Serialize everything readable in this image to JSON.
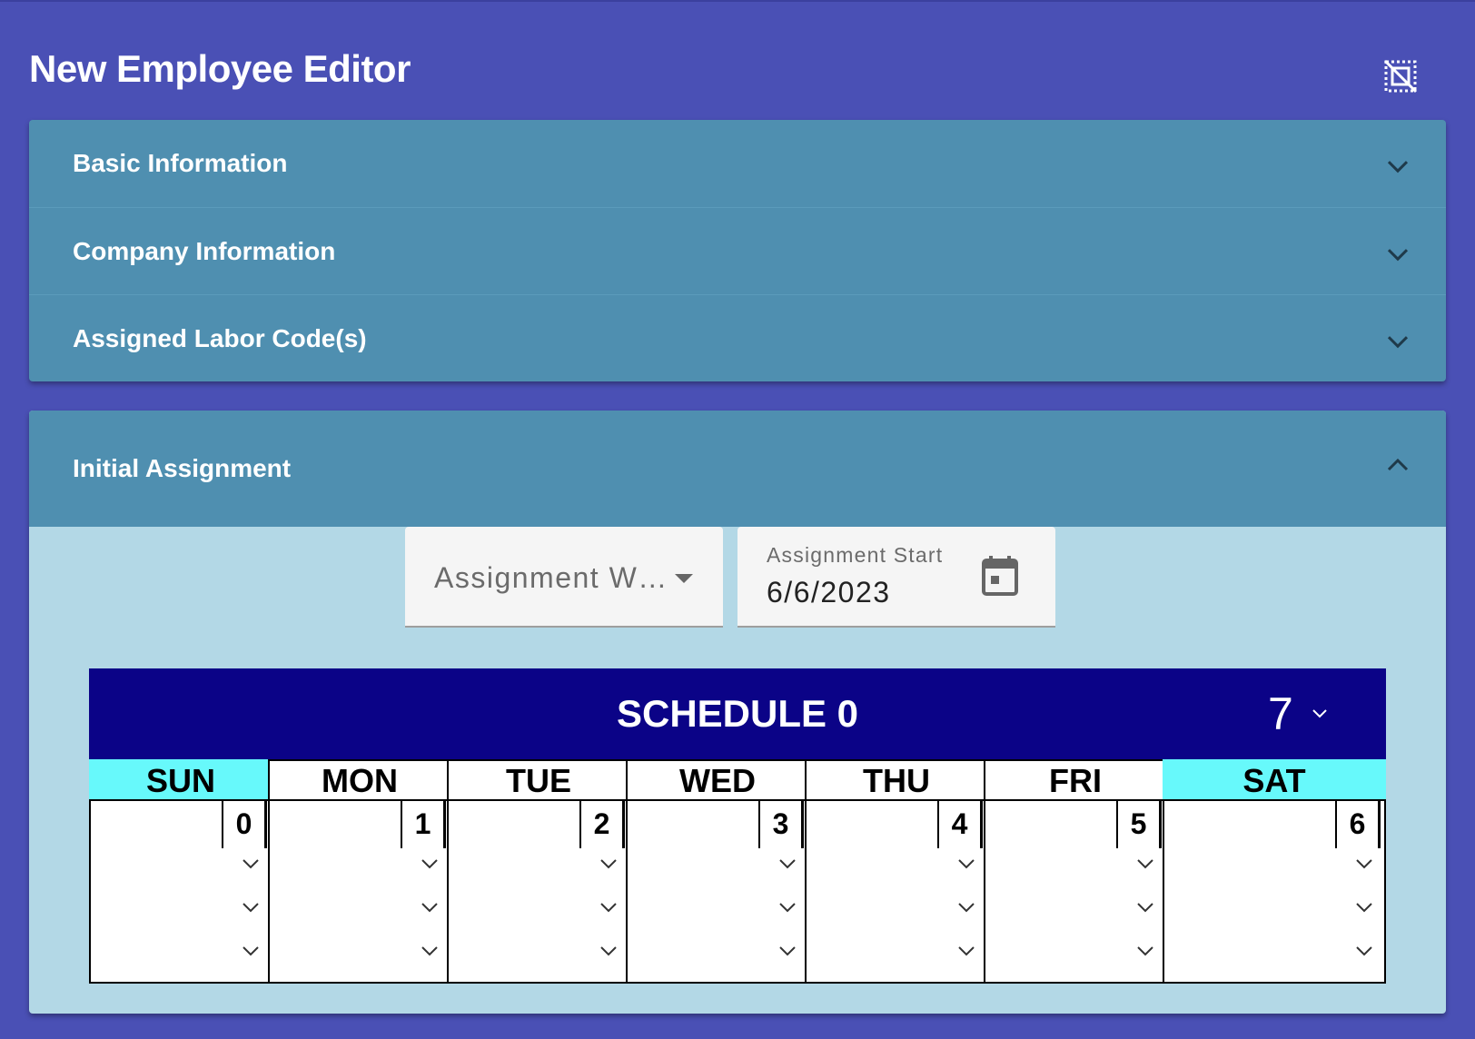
{
  "dialog": {
    "title": "New Employee Editor",
    "close_icon": "deselect-icon"
  },
  "panels": [
    {
      "label": "Basic Information",
      "expanded": false
    },
    {
      "label": "Company Information",
      "expanded": false
    },
    {
      "label": "Assigned Labor Code(s)",
      "expanded": false
    }
  ],
  "initial_assignment": {
    "label": "Initial Assignment",
    "expanded": true,
    "select": {
      "value": "Assignment W…"
    },
    "date": {
      "label": "Assignment Start",
      "value": "6/6/2023",
      "icon": "calendar-icon"
    }
  },
  "schedule": {
    "title": "SCHEDULE 0",
    "count": "7",
    "days": [
      {
        "name": "SUN",
        "num": "0",
        "weekend": true
      },
      {
        "name": "MON",
        "num": "1",
        "weekend": false
      },
      {
        "name": "TUE",
        "num": "2",
        "weekend": false
      },
      {
        "name": "WED",
        "num": "3",
        "weekend": false
      },
      {
        "name": "THU",
        "num": "4",
        "weekend": false
      },
      {
        "name": "FRI",
        "num": "5",
        "weekend": false
      },
      {
        "name": "SAT",
        "num": "6",
        "weekend": true
      }
    ]
  },
  "colors": {
    "background": "#4a50b5",
    "panel": "#4f8fb0",
    "panel_body": "#b3d8e6",
    "schedule_header": "#0b0387",
    "weekend": "#67f9fb"
  }
}
